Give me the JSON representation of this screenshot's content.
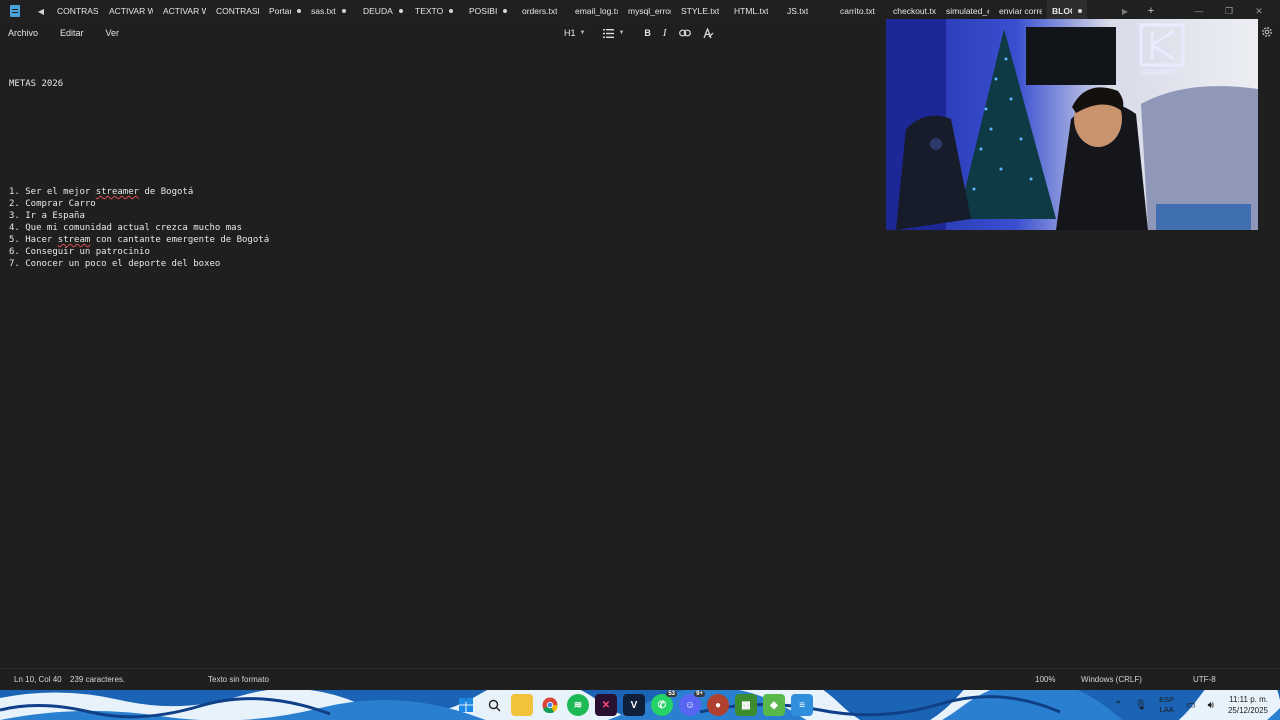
{
  "tabs": [
    {
      "label": "CONTRASEÑ",
      "dot": false,
      "active": false
    },
    {
      "label": "ACTIVAR WI",
      "dot": false,
      "active": false
    },
    {
      "label": "ACTIVAR WI",
      "dot": false,
      "active": false
    },
    {
      "label": "CONTRASEÑ",
      "dot": false,
      "active": false
    },
    {
      "label": "Portarl",
      "dot": true,
      "active": false
    },
    {
      "label": "sas.txt",
      "dot": true,
      "active": false
    },
    {
      "label": "DEUDA",
      "dot": true,
      "active": false
    },
    {
      "label": "TEXTO",
      "dot": true,
      "active": false
    },
    {
      "label": "POSIBI",
      "dot": true,
      "active": false
    },
    {
      "label": "orders.txt",
      "dot": false,
      "active": false
    },
    {
      "label": "email_log.txl",
      "dot": false,
      "active": false
    },
    {
      "label": "mysql_error.",
      "dot": false,
      "active": false
    },
    {
      "label": "STYLE.txt",
      "dot": false,
      "active": false
    },
    {
      "label": "HTML.txt",
      "dot": false,
      "active": false
    },
    {
      "label": "JS.txt",
      "dot": false,
      "active": false
    },
    {
      "label": "carrito.txt",
      "dot": false,
      "active": false
    },
    {
      "label": "checkout.txt",
      "dot": false,
      "active": false
    },
    {
      "label": "simulated_e",
      "dot": false,
      "active": false
    },
    {
      "label": "enviar corre",
      "dot": false,
      "active": false
    },
    {
      "label": "BLOG.I",
      "dot": true,
      "active": true
    }
  ],
  "tabbar": {
    "new_tab": "+"
  },
  "menu": [
    "Archivo",
    "Editar",
    "Ver"
  ],
  "format": {
    "heading": "H1"
  },
  "document": {
    "title": "METAS 2026",
    "items": [
      {
        "prefix": "1. Ser el mejor ",
        "mis": "streamer",
        "suffix": " de Bogotá"
      },
      {
        "prefix": "2. Comprar Carro",
        "mis": "",
        "suffix": ""
      },
      {
        "prefix": "3. Ir a España",
        "mis": "",
        "suffix": ""
      },
      {
        "prefix": "4. Que mi comunidad actual crezca mucho mas",
        "mis": "",
        "suffix": ""
      },
      {
        "prefix": "5. Hacer ",
        "mis": "stream",
        "suffix": " con cantante emergente de Bogotá"
      },
      {
        "prefix": "6. Conseguir un patrocinio",
        "mis": "",
        "suffix": ""
      },
      {
        "prefix": "7. Conocer un poco el deporte del boxeo",
        "mis": "",
        "suffix": ""
      }
    ]
  },
  "webcam": {
    "logo_text": "GRAINKO"
  },
  "status": {
    "position": "Ln 10, Col 40",
    "chars": "239 caracteres.",
    "format": "Texto sin formato",
    "zoom": "100%",
    "line_ending": "Windows (CRLF)",
    "encoding": "UTF-8"
  },
  "taskbar": {
    "whatsapp_badge": "53",
    "discord_badge": "9+",
    "lang_line1": "ESP",
    "lang_line2": "LAA",
    "time": "11:11 p. m.",
    "date": "25/12/2025"
  }
}
